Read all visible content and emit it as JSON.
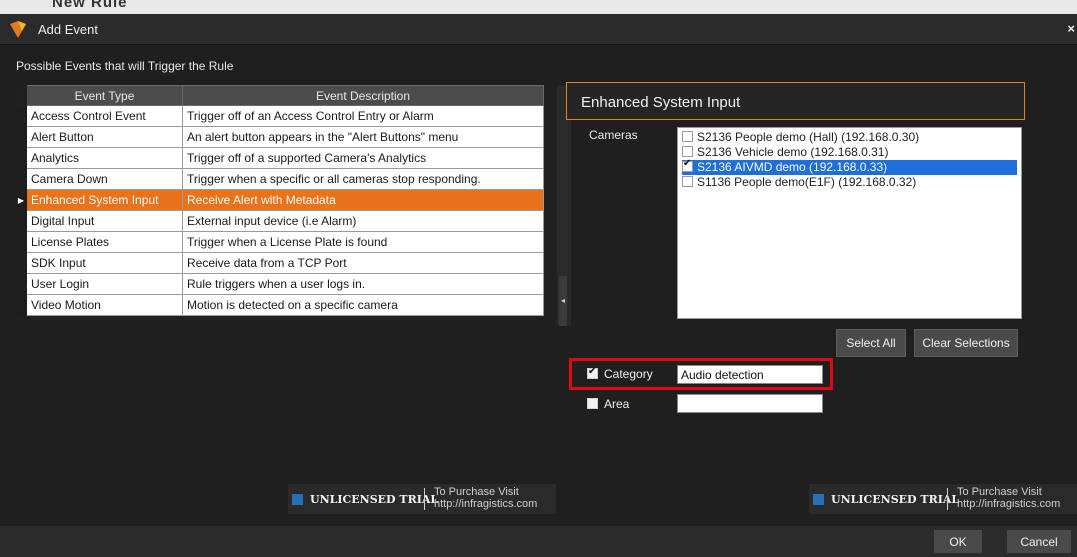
{
  "background_text": "New Rule",
  "window": {
    "title": "Add Event",
    "close": "×"
  },
  "subtitle": "Possible Events that will Trigger the Rule",
  "grid": {
    "columns": [
      "Event Type",
      "Event Description"
    ],
    "rows": [
      {
        "type": "Access Control Event",
        "desc": "Trigger off of an Access Control Entry or Alarm"
      },
      {
        "type": "Alert Button",
        "desc": "An alert button appears in the \"Alert Buttons\" menu"
      },
      {
        "type": "Analytics",
        "desc": "Trigger off of a supported Camera's Analytics"
      },
      {
        "type": "Camera Down",
        "desc": "Trigger when a specific or all cameras stop responding."
      },
      {
        "type": "Enhanced System Input",
        "desc": "Receive Alert with Metadata"
      },
      {
        "type": "Digital Input",
        "desc": "External input device (i.e Alarm)"
      },
      {
        "type": "License Plates",
        "desc": "Trigger when a License Plate is found"
      },
      {
        "type": "SDK Input",
        "desc": "Receive data from a TCP Port"
      },
      {
        "type": "User Login",
        "desc": "Rule triggers when a user logs in."
      },
      {
        "type": "Video Motion",
        "desc": "Motion is detected on a specific camera"
      }
    ],
    "selected_row": 4,
    "row_indicator": "▶"
  },
  "panel": {
    "title": "Enhanced System Input",
    "cameras_label": "Cameras",
    "cameras": [
      {
        "label": "S2136 People demo (Hall) (192.168.0.30)",
        "checked": false
      },
      {
        "label": "S2136 Vehicle demo (192.168.0.31)",
        "checked": false
      },
      {
        "label": "S2136 AIVMD demo (192.168.0.33)",
        "checked": true
      },
      {
        "label": "S1136 People demo(E1F) (192.168.0.32)",
        "checked": false
      }
    ],
    "select_all": "Select All",
    "clear_selections": "Clear Selections",
    "category": {
      "label": "Category",
      "checked": true,
      "value": "Audio detection"
    },
    "area": {
      "label": "Area",
      "checked": false,
      "value": ""
    }
  },
  "trial_banner": {
    "title": "UNLICENSED TRIAL",
    "line1": "To Purchase Visit",
    "line2": "http://infragistics.com"
  },
  "buttons": {
    "ok": "OK",
    "cancel": "Cancel"
  },
  "colors": {
    "selection_orange": "#e8731c",
    "accent_border": "#d8862b",
    "highlight_red": "#e30613",
    "list_selection_blue": "#1e6fd9"
  }
}
